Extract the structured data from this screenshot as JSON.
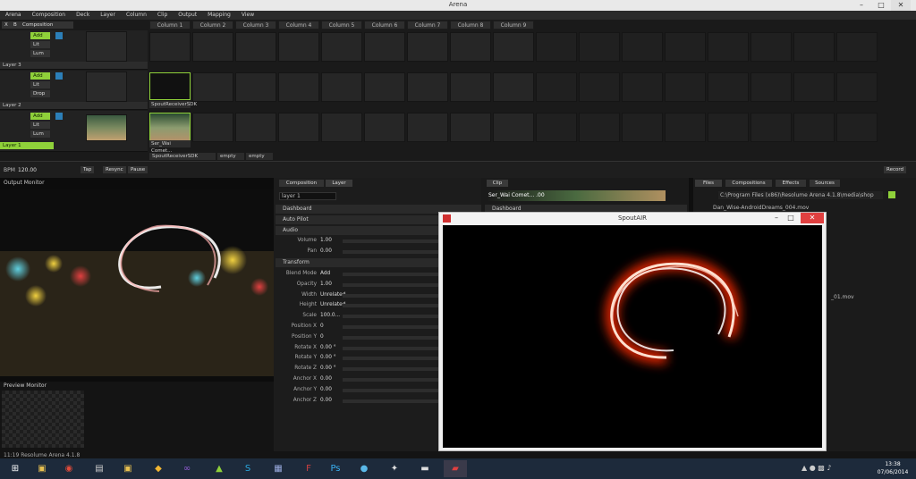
{
  "window": {
    "title": "Arena"
  },
  "menu": [
    "Arena",
    "Composition",
    "Deck",
    "Layer",
    "Column",
    "Clip",
    "Output",
    "Mapping",
    "View"
  ],
  "deck": {
    "composition_label": "Composition",
    "columns": [
      "Column 1",
      "Column 2",
      "Column 3",
      "Column 4",
      "Column 5",
      "Column 6",
      "Column 7",
      "Column 8",
      "Column 9"
    ],
    "layers": [
      {
        "name": "Layer 3",
        "blend": "Add",
        "mode2": "Lit",
        "mode3": "Lum"
      },
      {
        "name": "Layer 2",
        "blend": "Add",
        "mode2": "Lit",
        "mode3": "Drop"
      },
      {
        "name": "Layer 1",
        "blend": "Add",
        "mode2": "Lit",
        "mode3": "Lum"
      }
    ],
    "clip_labels": [
      "SpoutReceiverSDK",
      "Ser_Wai Comet..."
    ],
    "layer2_clip": "SpoutReceiverSDK",
    "bottom_row": [
      "SpoutReceiverSDK",
      "empty",
      "empty"
    ]
  },
  "transport": {
    "bpm_label": "BPM",
    "bpm": "120.00",
    "btn_tap": "Tap",
    "btn_resync": "Resync",
    "btn_pause": "Pause",
    "record": "Record"
  },
  "output_monitor": {
    "title": "Output Monitor"
  },
  "preview_monitor": {
    "title": "Preview Monitor"
  },
  "center": {
    "tabs": [
      "Composition",
      "Layer"
    ],
    "layer_name": "layer 1",
    "sections": {
      "dashboard": "Dashboard",
      "autopilot": "Auto Pilot",
      "audio": "Audio",
      "transform": "Transform"
    },
    "audio": {
      "volume_label": "Volume",
      "volume": "1.00",
      "pan_label": "Pan",
      "pan": "0.00"
    },
    "transform": [
      {
        "label": "Blend Mode",
        "value": "Add"
      },
      {
        "label": "Opacity",
        "value": "1.00"
      },
      {
        "label": "Width",
        "value": "Unrelated"
      },
      {
        "label": "Height",
        "value": "Unrelated"
      },
      {
        "label": "Scale",
        "value": "100.0..."
      },
      {
        "label": "Position X",
        "value": "0"
      },
      {
        "label": "Position Y",
        "value": "0"
      },
      {
        "label": "Rotate X",
        "value": "0.00 °"
      },
      {
        "label": "Rotate Y",
        "value": "0.00 °"
      },
      {
        "label": "Rotate Z",
        "value": "0.00 °"
      },
      {
        "label": "Anchor X",
        "value": "0.00"
      },
      {
        "label": "Anchor Y",
        "value": "0.00"
      },
      {
        "label": "Anchor Z",
        "value": "0.00"
      }
    ]
  },
  "clip": {
    "tab": "Clip",
    "name": "Ser_Wai Comet... .00",
    "dashboard": "Dashboard"
  },
  "files": {
    "tabs": [
      "Files",
      "Compositions",
      "Effects",
      "Sources"
    ],
    "path": "C:\\Program Files (x86)\\Resolume Arena 4.1.8\\media\\shop",
    "items": [
      "Dan_Wise-AndroidDreams_004.mov",
      "_01.mov"
    ]
  },
  "spout": {
    "title": "SpoutAIR"
  },
  "status": {
    "text": "11:19  Resolume Arena 4.1.8"
  },
  "taskbar": {
    "time": "13:38",
    "date": "07/06/2014"
  },
  "colors": {
    "accent": "#8fd13a",
    "blue": "#2c7fb8",
    "glow": "#ff2a00"
  }
}
